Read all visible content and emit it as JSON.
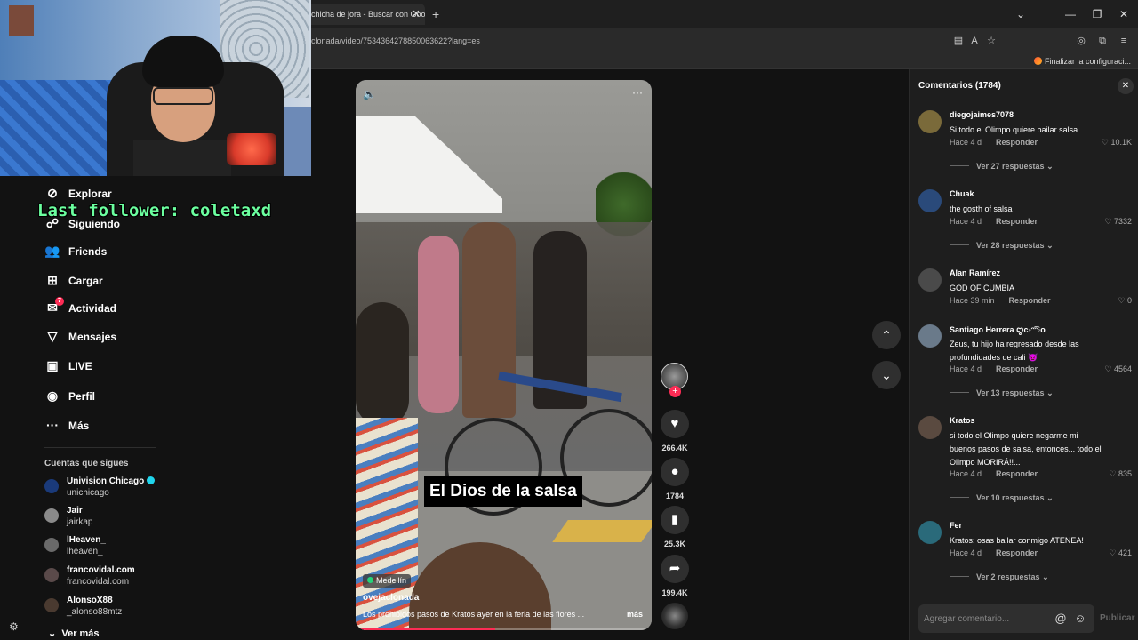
{
  "browser": {
    "tab_title": "chicha de jora - Buscar con Goo",
    "url": "clonada/video/7534364278850063622?lang=es",
    "bookmark": "Finalizar la configuraci..."
  },
  "overlay": {
    "follower": "Last follower: coletaxd"
  },
  "sidebar": {
    "items": [
      {
        "label": "Explorar",
        "icon": "compass-icon",
        "glyph": "⊘"
      },
      {
        "label": "Siguiendo",
        "icon": "following-icon",
        "glyph": "☍"
      },
      {
        "label": "Friends",
        "icon": "friends-icon",
        "glyph": "👥"
      },
      {
        "label": "Cargar",
        "icon": "upload-icon",
        "glyph": "⊞"
      },
      {
        "label": "Actividad",
        "icon": "activity-icon",
        "glyph": "✉",
        "badge": "7"
      },
      {
        "label": "Mensajes",
        "icon": "messages-icon",
        "glyph": "▽"
      },
      {
        "label": "LIVE",
        "icon": "live-icon",
        "glyph": "▣"
      },
      {
        "label": "Perfil",
        "icon": "profile-icon",
        "glyph": "◉"
      },
      {
        "label": "Más",
        "icon": "more-icon",
        "glyph": "···"
      }
    ],
    "following_title": "Cuentas que sigues",
    "accounts": [
      {
        "name": "Univision Chicago",
        "handle": "unichicago",
        "verified": true,
        "color": "#1a3a7a"
      },
      {
        "name": "Jair",
        "handle": "jairkap",
        "verified": false,
        "color": "#8a8a8a"
      },
      {
        "name": "lHeaven_",
        "handle": "lheaven_",
        "verified": false,
        "color": "#6a6a6a"
      },
      {
        "name": "francovidal.com",
        "handle": "francovidal.com",
        "verified": false,
        "color": "#5a4a4a"
      },
      {
        "name": "AlonsoX88",
        "handle": "_alonso88mtz",
        "verified": false,
        "color": "#4a3a30"
      }
    ],
    "see_more": "Ver más"
  },
  "video": {
    "caption": "El Dios de la salsa",
    "location": "Medellín",
    "username": "ovejaclonada",
    "description": "Los prohibidos pasos de Kratos ayer en la feria de las flores ...",
    "more": "más",
    "progress": 0.47
  },
  "actions": {
    "likes": "266.4K",
    "comments": "1784",
    "saves": "25.3K",
    "shares": "199.4K"
  },
  "comments_panel": {
    "title": "Comentarios (1784)",
    "input_placeholder": "Agregar comentario...",
    "post_label": "Publicar",
    "reply_label": "Responder",
    "items": [
      {
        "user": "diegojaimes7078",
        "text": "Si todo el Olimpo quiere bailar salsa",
        "time": "Hace 4 d",
        "likes": "10.1K",
        "replies": "Ver 27 respuestas",
        "color": "#7a6a3a"
      },
      {
        "user": "Chuak",
        "text": "the gosth of salsa",
        "time": "Hace 4 d",
        "likes": "7332",
        "replies": "Ver 28 respuestas",
        "color": "#2a4a7a"
      },
      {
        "user": "Alan Ramírez",
        "text": "GOD OF CUMBIA",
        "time": "Hace 39 min",
        "likes": "0",
        "replies": "",
        "color": "#4a4a4a"
      },
      {
        "user": "Santiago Herrera ꨄ︎c◦ᵔ͡ᵔ◦o",
        "text": "Zeus, tu hijo ha regresado desde las profundidades de cali 👿",
        "time": "Hace 4 d",
        "likes": "4564",
        "replies": "Ver 13 respuestas",
        "color": "#6a7a8a"
      },
      {
        "user": "Kratos",
        "text": "si todo el Olimpo quiere negarme mi buenos pasos de salsa, entonces... todo el Olimpo MORIRÁ!!...",
        "time": "Hace 4 d",
        "likes": "835",
        "replies": "Ver 10 respuestas",
        "color": "#5a4a40"
      },
      {
        "user": "Fer",
        "text": "Kratos: osas bailar conmigo ATENEA!",
        "time": "Hace 4 d",
        "likes": "421",
        "replies": "Ver 2 respuestas",
        "color": "#2a6a7a"
      }
    ]
  }
}
